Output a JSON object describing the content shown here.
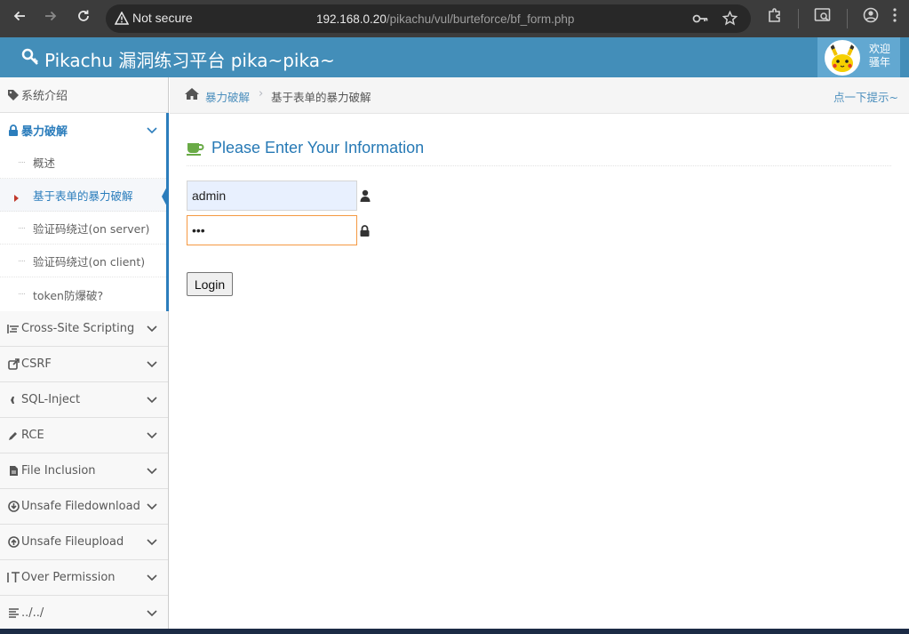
{
  "browser": {
    "security_label": "Not secure",
    "url_host": "192.168.0.20",
    "url_path": "/pikachu/vul/burteforce/bf_form.php"
  },
  "header": {
    "brand": "Pikachu 漏洞练习平台 pika~pika~",
    "user_line1": "欢迎",
    "user_line2": "骚年"
  },
  "sidebar": {
    "intro": "系统介绍",
    "brute": "暴力破解",
    "sub": [
      "概述",
      "基于表单的暴力破解",
      "验证码绕过(on server)",
      "验证码绕过(on client)",
      "token防爆破?"
    ],
    "items": [
      "Cross-Site Scripting",
      "CSRF",
      "SQL-Inject",
      "RCE",
      "File Inclusion",
      "Unsafe Filedownload",
      "Unsafe Fileupload",
      "Over Permission",
      "../../"
    ]
  },
  "breadcrumb": {
    "parent": "暴力破解",
    "separator": "›",
    "current": "基于表单的暴力破解",
    "hint": "点一下提示~"
  },
  "form": {
    "title": "Please Enter Your Information",
    "username": "admin",
    "password_mask": "•••",
    "login_label": "Login"
  },
  "colors": {
    "header": "#438eb9",
    "accent": "#2b7dbc",
    "title": "#2679b5",
    "focus_border": "#f59942"
  }
}
